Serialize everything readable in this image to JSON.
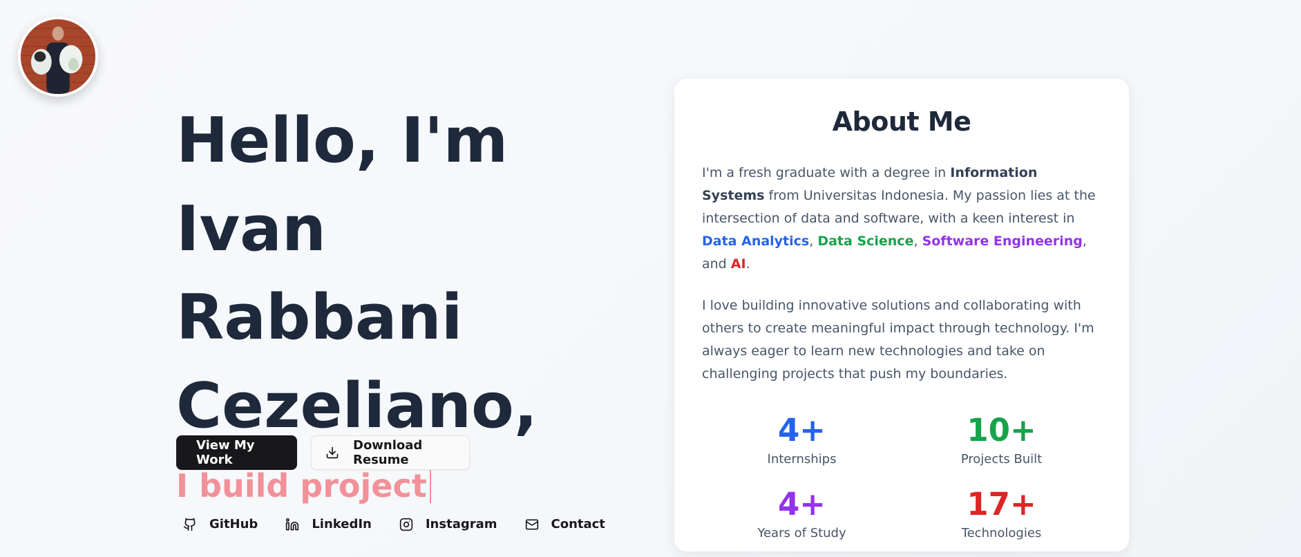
{
  "avatar": {
    "alt": "Profile photo"
  },
  "hero": {
    "line1": "Hello, I'm",
    "line2": "Ivan Rabbani",
    "line3": "Cezeliano,",
    "typing": "I build project"
  },
  "buttons": {
    "view_work": "View My Work",
    "download_resume": "Download Resume"
  },
  "socials": [
    {
      "label": "GitHub",
      "icon": "github-icon"
    },
    {
      "label": "LinkedIn",
      "icon": "linkedin-icon"
    },
    {
      "label": "Instagram",
      "icon": "instagram-icon"
    },
    {
      "label": "Contact",
      "icon": "mail-icon"
    }
  ],
  "about": {
    "title": "About Me",
    "p1": {
      "t1": "I'm a fresh graduate with a degree in ",
      "bold": "Information Systems",
      "t2": " from Universitas Indonesia. My passion lies at the intersection of data and software, with a keen interest in ",
      "hl1": "Data Analytics",
      "sep1": ", ",
      "hl2": "Data Science",
      "sep2": ", ",
      "hl3": "Software Engineering",
      "sep3": ", and ",
      "hl4": "AI",
      "end": "."
    },
    "p2": "I love building innovative solutions and collaborating with others to create meaningful impact through technology. I'm always eager to learn new technologies and take on challenging projects that push my boundaries.",
    "stats": [
      {
        "value": "4+",
        "label": "Internships",
        "color": "#2563eb"
      },
      {
        "value": "10+",
        "label": "Projects Built",
        "color": "#16a34a"
      },
      {
        "value": "4+",
        "label": "Years of Study",
        "color": "#9333ea"
      },
      {
        "value": "17+",
        "label": "Technologies",
        "color": "#dc2626"
      }
    ]
  },
  "colors": {
    "heading": "#1e293b",
    "accent_pink": "#f19199",
    "primary_button": "#18181b"
  }
}
